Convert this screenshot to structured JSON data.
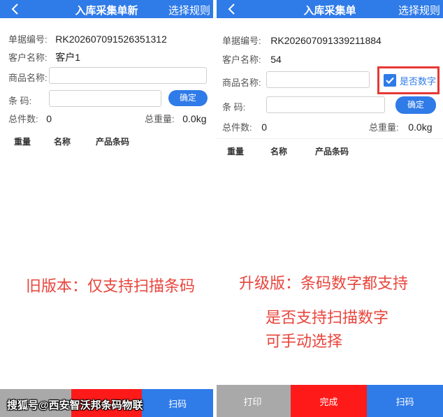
{
  "left": {
    "title": "入库采集单新",
    "rule_label": "选择规则",
    "doc_no_label": "单据编号:",
    "doc_no": "RK202607091526351312",
    "customer_label": "客户名称:",
    "customer": "客户1",
    "product_label": "商品名称:",
    "barcode_label": "条  码:",
    "confirm_label": "确定",
    "total_count_label": "总件数:",
    "total_count": "0",
    "total_weight_label": "总重量:",
    "total_weight": "0.0kg",
    "columns": [
      "重量",
      "名称",
      "产品条码"
    ],
    "buttons": [
      "扫码"
    ],
    "note": "旧版本：仅支持扫描条码"
  },
  "right": {
    "title": "入库采集单",
    "rule_label": "选择规则",
    "doc_no_label": "单据编号:",
    "doc_no": "RK202607091339211884",
    "customer_label": "客户名称:",
    "customer": "54",
    "product_label": "商品名称:",
    "is_number_label": "是否数字",
    "barcode_label": "条  码:",
    "confirm_label": "确定",
    "total_count_label": "总件数:",
    "total_count": "0",
    "total_weight_label": "总重量:",
    "total_weight": "0.0kg",
    "columns": [
      "重量",
      "名称",
      "产品条码"
    ],
    "buttons": [
      "打印",
      "完成",
      "扫码"
    ],
    "note_line1": "升级版：条码数字都支持",
    "note_line2": "是否支持扫描数字",
    "note_line3": "可手动选择"
  },
  "watermark": "搜狐号@西安智沃邦条码物联",
  "colors": {
    "primary": "#2f7be8",
    "danger": "#ff1a1a",
    "gray": "#a9a9a9",
    "note": "#e8453c"
  }
}
